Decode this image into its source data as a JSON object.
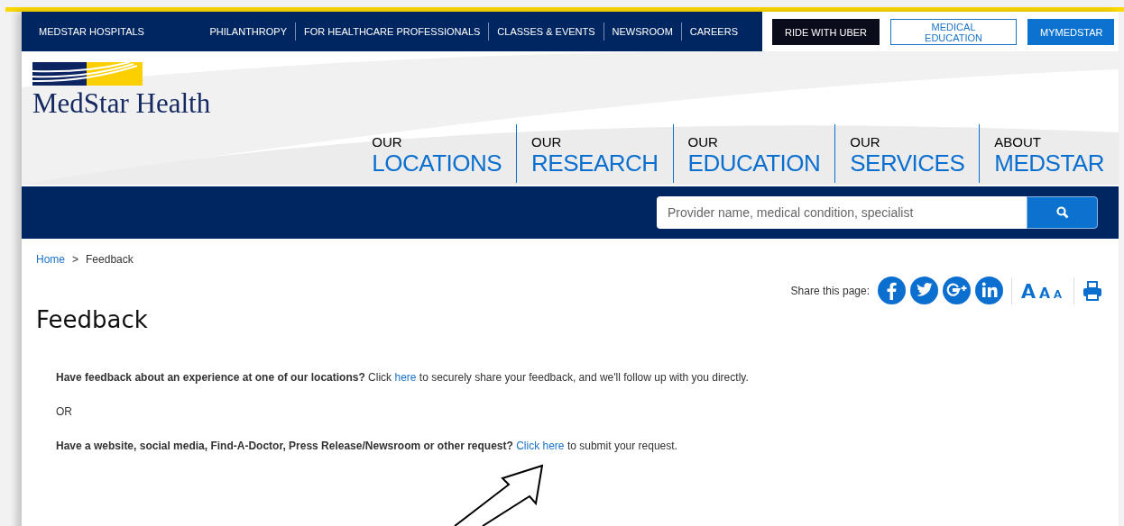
{
  "top_bar": {
    "brand_link": "MEDSTAR HOSPITALS",
    "links": [
      "PHILANTHROPY",
      "FOR HEALTHCARE PROFESSIONALS",
      "CLASSES & EVENTS",
      "NEWSROOM",
      "CAREERS"
    ],
    "buttons": [
      {
        "label": "RIDE WITH UBER",
        "kind": "dark"
      },
      {
        "label": "MEDICAL EDUCATION",
        "kind": "outline"
      },
      {
        "label": "MYMEDSTAR",
        "kind": "solid"
      }
    ]
  },
  "logo": {
    "text": "MedStar Health"
  },
  "main_nav": [
    {
      "small": "OUR",
      "large": "LOCATIONS"
    },
    {
      "small": "OUR",
      "large": "RESEARCH"
    },
    {
      "small": "OUR",
      "large": "EDUCATION"
    },
    {
      "small": "OUR",
      "large": "SERVICES"
    },
    {
      "small": "ABOUT",
      "large": "MEDSTAR"
    }
  ],
  "search": {
    "placeholder": "Provider name, medical condition, specialist"
  },
  "breadcrumb": {
    "home": "Home",
    "separator": ">",
    "current": "Feedback"
  },
  "share": {
    "label": "Share this page:"
  },
  "page_title": "Feedback",
  "paragraphs": [
    {
      "kind": "link",
      "bold": "Have feedback about an experience at one of our locations?",
      "before": "Click ",
      "link": "here",
      "after": " to securely share your feedback, and we'll follow up with you directly."
    },
    {
      "kind": "plain",
      "text": "OR"
    },
    {
      "kind": "link",
      "bold": "Have a website, social media, Find-A-Doctor, Press Release/Newsroom or other request?",
      "link": "Click here",
      "after": " to submit your request."
    }
  ]
}
